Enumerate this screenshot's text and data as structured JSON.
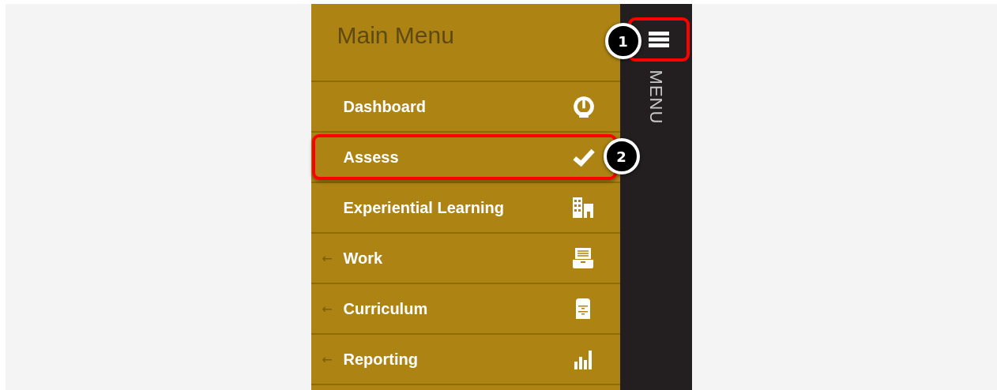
{
  "menu_panel": {
    "title": "Main Menu"
  },
  "side_strip": {
    "menu_button": {
      "highlighted": true,
      "callout": "1"
    },
    "label": "MENU"
  },
  "items": [
    {
      "label": "Dashboard",
      "highlighted": false
    },
    {
      "label": "Assess",
      "highlighted": true,
      "callout": "2"
    },
    {
      "label": "Experiential Learning",
      "highlighted": false
    },
    {
      "label": "Work",
      "arrow": "←",
      "highlighted": false
    },
    {
      "label": "Curriculum",
      "arrow": "←",
      "highlighted": false
    },
    {
      "label": "Reporting",
      "arrow": "←",
      "highlighted": false
    }
  ]
}
